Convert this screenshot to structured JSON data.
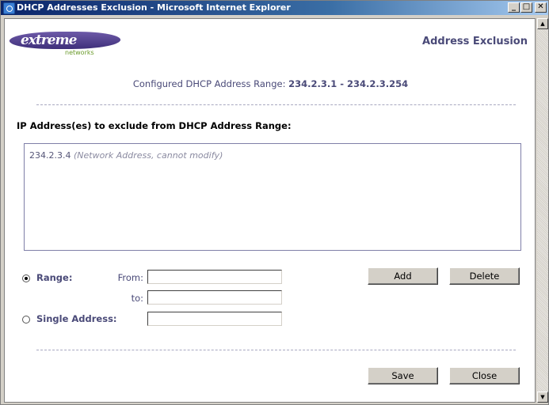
{
  "window": {
    "title": "DHCP Addresses Exclusion - Microsoft Internet Explorer",
    "controls": {
      "minimize": "_",
      "maximize": "□",
      "close": "✕"
    }
  },
  "header": {
    "logo_text": "extreme",
    "logo_subtext": "networks",
    "page_title": "Address Exclusion"
  },
  "range": {
    "label": "Configured DHCP Address Range:",
    "value": "234.2.3.1 - 234.2.3.254"
  },
  "exclusion": {
    "section_label": "IP Address(es) to exclude from DHCP Address Range:",
    "items": [
      {
        "address": "234.2.3.4",
        "note": "(Network Address, cannot modify)"
      }
    ]
  },
  "form": {
    "range_label": "Range:",
    "from_label": "From:",
    "to_label": "to:",
    "from_value": "",
    "to_value": "",
    "single_label": "Single Address:",
    "single_value": "",
    "selected": "range"
  },
  "buttons": {
    "add": "Add",
    "delete": "Delete",
    "save": "Save",
    "close": "Close"
  },
  "colors": {
    "title_bar": "#0a246a",
    "accent_text": "#4a4a78",
    "logo": "#4b3a8c",
    "logo_sub": "#6a9a2a"
  }
}
